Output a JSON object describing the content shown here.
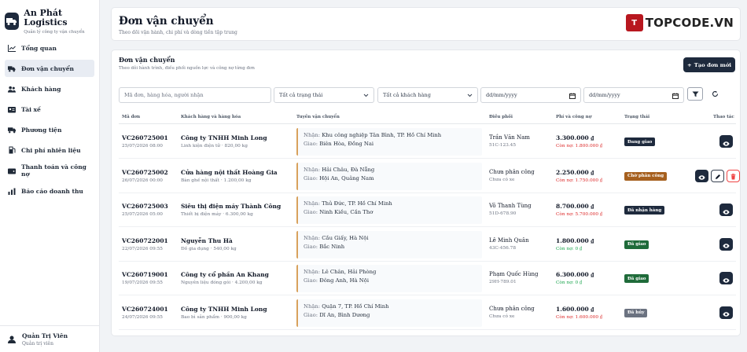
{
  "app": {
    "name": "An Phát Logistics",
    "tagline": "Quản lý công ty vận chuyển"
  },
  "nav": [
    {
      "label": "Tổng quan",
      "icon": "chart-line-icon",
      "active": false
    },
    {
      "label": "Đơn vận chuyển",
      "icon": "truck-icon",
      "active": true
    },
    {
      "label": "Khách hàng",
      "icon": "users-icon",
      "active": false
    },
    {
      "label": "Tài xế",
      "icon": "id-card-icon",
      "active": false
    },
    {
      "label": "Phương tiện",
      "icon": "vehicle-icon",
      "active": false
    },
    {
      "label": "Chi phí nhiên liệu",
      "icon": "fuel-icon",
      "active": false
    },
    {
      "label": "Thanh toán và công nợ",
      "icon": "wallet-icon",
      "active": false
    },
    {
      "label": "Báo cáo doanh thu",
      "icon": "bar-chart-icon",
      "active": false
    }
  ],
  "user": {
    "name": "Quản Trị Viên",
    "role": "Quản trị viên"
  },
  "header": {
    "title": "Đơn vận chuyển",
    "subtitle": "Theo dõi vận hành, chi phí và dòng tiền tập trung"
  },
  "brand_logo": {
    "mark": "T",
    "text": "TOPCODE.VN"
  },
  "card": {
    "title": "Đơn vận chuyển",
    "subtitle": "Theo dõi hành trình, điều phối nguồn lực và công nợ từng đơn",
    "create_label": "Tạo đơn mới"
  },
  "filters": {
    "search_placeholder": "Mã đơn, hàng hóa, người nhận",
    "status_value": "Tất cả trạng thái",
    "customer_value": "Tất cả khách hàng",
    "date_from_placeholder": "dd/mm/yyyy",
    "date_to_placeholder": "dd/mm/yyyy"
  },
  "columns": [
    "Mã đơn",
    "Khách hàng và hàng hóa",
    "Tuyến vận chuyển",
    "Điều phối",
    "Phí và công nợ",
    "Trạng thái",
    "Thao tác"
  ],
  "route_labels": {
    "pickup": "Nhận:",
    "delivery": "Giao:"
  },
  "orders": [
    {
      "code": "VC260725001",
      "datetime": "25/07/2026 08:00",
      "customer": "Công ty TNHH Minh Long",
      "goods": "Linh kiện điện tử · 820,00 kg",
      "pickup": "Khu công nghiệp Tân Bình, TP. Hồ Chí Minh",
      "delivery": "Biên Hòa, Đồng Nai",
      "driver": "Trần Văn Nam",
      "plate": "51C-123.45",
      "fee": "3.300.000 ₫",
      "debt": "Còn nợ: 1.800.000 ₫",
      "debt_color": "#dc2626",
      "status": "Đang giao",
      "status_color": "#1e2a3d",
      "actions": "view"
    },
    {
      "code": "VC260725002",
      "datetime": "26/07/2026 00:00",
      "customer": "Cửa hàng nội thất Hoàng Gia",
      "goods": "Bàn ghế nội thất · 1.200,00 kg",
      "pickup": "Hải Châu, Đà Nẵng",
      "delivery": "Hội An, Quảng Nam",
      "driver": "Chưa phân công",
      "plate": "Chưa có xe",
      "fee": "2.250.000 ₫",
      "debt": "Còn nợ: 1.750.000 ₫",
      "debt_color": "#dc2626",
      "status": "Chờ phân công",
      "status_color": "#a6601f",
      "actions": "all"
    },
    {
      "code": "VC260725003",
      "datetime": "25/07/2026 05:00",
      "customer": "Siêu thị điện máy Thành Công",
      "goods": "Thiết bị điện máy · 6.300,00 kg",
      "pickup": "Thủ Đức, TP. Hồ Chí Minh",
      "delivery": "Ninh Kiều, Cần Thơ",
      "driver": "Võ Thanh Tùng",
      "plate": "51D-678.90",
      "fee": "8.700.000 ₫",
      "debt": "Còn nợ: 5.700.000 ₫",
      "debt_color": "#dc2626",
      "status": "Đã nhận hàng",
      "status_color": "#1e2a3d",
      "actions": "view"
    },
    {
      "code": "VC260722001",
      "datetime": "22/07/2026 09:55",
      "customer": "Nguyễn Thu Hà",
      "goods": "Đồ gia dụng · 540,00 kg",
      "pickup": "Cầu Giấy, Hà Nội",
      "delivery": "Bắc Ninh",
      "driver": "Lê Minh Quân",
      "plate": "43C-456.78",
      "fee": "1.800.000 ₫",
      "debt": "Còn nợ: 0 ₫",
      "debt_color": "#16a34a",
      "status": "Đã giao",
      "status_color": "#1f6b3a",
      "actions": "view"
    },
    {
      "code": "VC260719001",
      "datetime": "19/07/2026 09:55",
      "customer": "Công ty cổ phần An Khang",
      "goods": "Nguyên liệu đóng gói · 4.200,00 kg",
      "pickup": "Lê Chân, Hải Phòng",
      "delivery": "Đông Anh, Hà Nội",
      "driver": "Phạm Quốc Hùng",
      "plate": "29H-789.01",
      "fee": "6.300.000 ₫",
      "debt": "Còn nợ: 0 ₫",
      "debt_color": "#16a34a",
      "status": "Đã giao",
      "status_color": "#1f6b3a",
      "actions": "view"
    },
    {
      "code": "VC260724001",
      "datetime": "24/07/2026 09:55",
      "customer": "Công ty TNHH Minh Long",
      "goods": "Bao bì sản phẩm · 900,00 kg",
      "pickup": "Quận 7, TP. Hồ Chí Minh",
      "delivery": "Dĩ An, Bình Dương",
      "driver": "Chưa phân công",
      "plate": "Chưa có xe",
      "fee": "1.600.000 ₫",
      "debt": "Còn nợ: 1.600.000 ₫",
      "debt_color": "#dc2626",
      "status": "Đã hủy",
      "status_color": "#6b7280",
      "actions": "view"
    }
  ]
}
